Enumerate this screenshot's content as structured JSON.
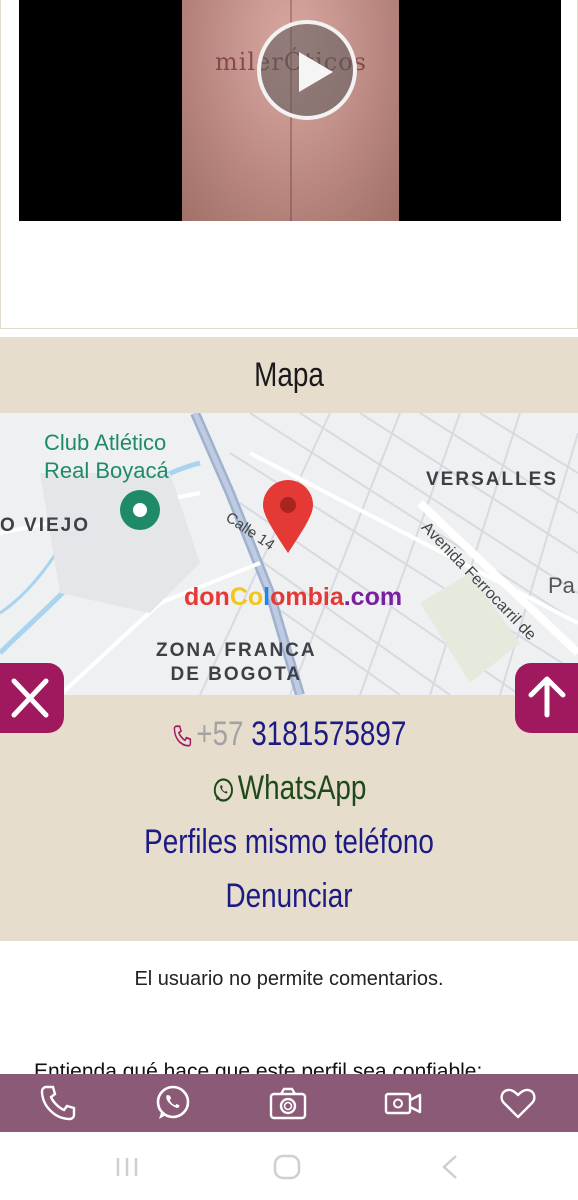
{
  "video": {
    "watermark": "milerÓticos"
  },
  "map_section": {
    "title": "Mapa",
    "labels": {
      "club": [
        "Club Atlético",
        "Real Boyacá"
      ],
      "viejo": "O VIEJO",
      "versalles": "VERSALLES",
      "zona_franca": [
        "ZONA FRANCA",
        "DE BOGOTA"
      ],
      "calle": "Calle 14",
      "avenida": "Avenida Ferrocarril de",
      "pa": "Pa"
    },
    "brand_watermark": {
      "parts": [
        "don",
        "Co",
        "l",
        "ombia",
        ".com"
      ],
      "colors": [
        "#e53935",
        "#f5c518",
        "#1e88e5",
        "#e53935",
        "#7b1fa2"
      ]
    }
  },
  "contacts": {
    "phone_prefix": "+57",
    "phone_number": "3181575897",
    "whatsapp": "WhatsApp",
    "same_phone_profiles": "Perfiles mismo teléfono",
    "report": "Denunciar"
  },
  "comments_note": "El usuario no permite comentarios.",
  "trust_heading": "Entienda qué hace que este perfil sea confiable:",
  "bottom_bar": {
    "items": [
      "phone-icon",
      "whatsapp-icon",
      "camera-icon",
      "video-icon",
      "heart-icon"
    ]
  },
  "colors": {
    "accent": "#a0195e",
    "section_bg": "#e6ddcd",
    "bottom_bar": "#8b5a76",
    "link": "#1c1b84"
  }
}
